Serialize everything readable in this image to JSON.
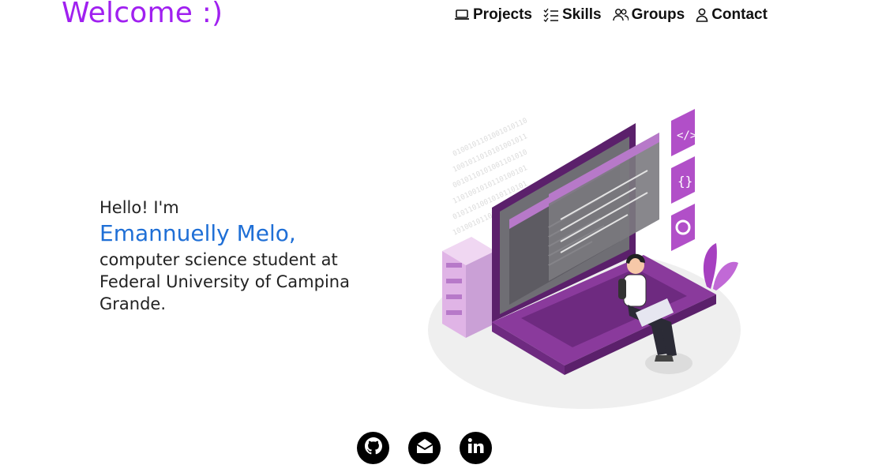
{
  "header": {
    "brand": "Welcome :)",
    "nav": [
      {
        "label": "Projects",
        "icon": "laptop-icon"
      },
      {
        "label": "Skills",
        "icon": "checklist-icon"
      },
      {
        "label": "Groups",
        "icon": "people-icon"
      },
      {
        "label": "Contact",
        "icon": "person-icon"
      }
    ]
  },
  "hero": {
    "greeting": "Hello! I'm",
    "name": "Emannuelly Melo,",
    "description": "computer science student at Federal University of Campina Grande."
  },
  "socials": [
    {
      "icon": "github-icon"
    },
    {
      "icon": "email-icon"
    },
    {
      "icon": "linkedin-icon"
    }
  ],
  "colors": {
    "accent": "#a020f0",
    "name": "#1f6fd6",
    "illustration_purple": "#8a3a9c"
  }
}
